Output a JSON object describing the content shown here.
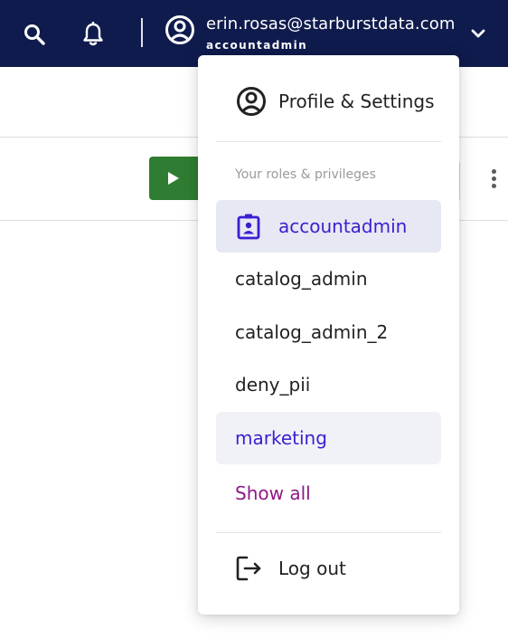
{
  "header": {
    "search_icon": "search-icon",
    "notifications_icon": "bell-icon",
    "account": {
      "email": "erin.rosas@starburstdata.com",
      "role": "accountadmin",
      "avatar_icon": "user-circle-icon",
      "chevron_icon": "chevron-down-icon"
    },
    "bg_color": "#101b4d"
  },
  "page": {
    "run_button_icon": "play-icon",
    "run_button_color": "#2f7d32",
    "more_icon": "kebab-icon"
  },
  "menu": {
    "profile_label": "Profile & Settings",
    "roles_heading": "Your roles & privileges",
    "roles": [
      {
        "name": "accountadmin",
        "state": "selected"
      },
      {
        "name": "catalog_admin",
        "state": "normal"
      },
      {
        "name": "catalog_admin_2",
        "state": "normal"
      },
      {
        "name": "deny_pii",
        "state": "normal"
      },
      {
        "name": "marketing",
        "state": "hovered"
      }
    ],
    "show_all_label": "Show all",
    "logout_label": "Log out",
    "colors": {
      "selected_bg": "#e6e8f3",
      "hover_bg": "#f1f2f7",
      "accent_text": "#3a1fd1",
      "link_text": "#8f1a86"
    }
  }
}
